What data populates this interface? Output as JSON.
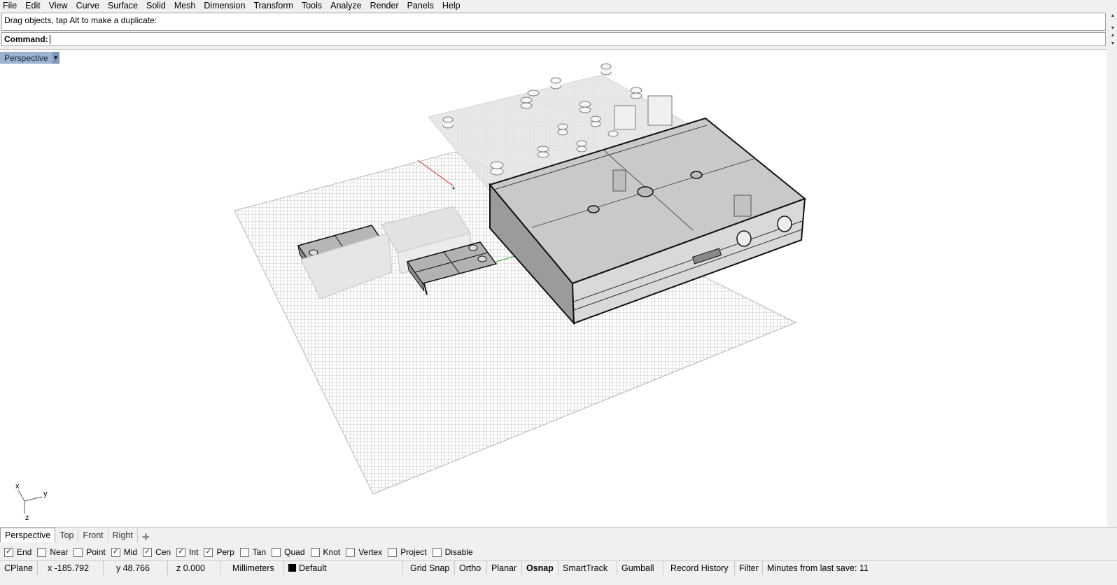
{
  "menu": [
    "File",
    "Edit",
    "View",
    "Curve",
    "Surface",
    "Solid",
    "Mesh",
    "Dimension",
    "Transform",
    "Tools",
    "Analyze",
    "Render",
    "Panels",
    "Help"
  ],
  "history": {
    "text": "Drag objects, tap Alt to make a duplicate:"
  },
  "command": {
    "label": "Command:",
    "value": ""
  },
  "viewport": {
    "title": "Perspective",
    "axis": {
      "x": "x",
      "y": "y",
      "z": "z"
    }
  },
  "tabs": [
    "Perspective",
    "Top",
    "Front",
    "Right"
  ],
  "osnaps": [
    {
      "label": "End",
      "checked": true
    },
    {
      "label": "Near",
      "checked": false
    },
    {
      "label": "Point",
      "checked": false
    },
    {
      "label": "Mid",
      "checked": true
    },
    {
      "label": "Cen",
      "checked": true
    },
    {
      "label": "Int",
      "checked": true
    },
    {
      "label": "Perp",
      "checked": true
    },
    {
      "label": "Tan",
      "checked": false
    },
    {
      "label": "Quad",
      "checked": false
    },
    {
      "label": "Knot",
      "checked": false
    },
    {
      "label": "Vertex",
      "checked": false
    },
    {
      "label": "Project",
      "checked": false
    },
    {
      "label": "Disable",
      "checked": false
    }
  ],
  "status": {
    "cplane": "CPlane",
    "x": "x -185.792",
    "y": "y 48.766",
    "z": "z 0.000",
    "units": "Millimeters",
    "layer": "Default",
    "grid_snap": "Grid Snap",
    "ortho": "Ortho",
    "planar": "Planar",
    "osnap": "Osnap",
    "smarttrack": "SmartTrack",
    "gumball": "Gumball",
    "record_history": "Record History",
    "filter": "Filter",
    "save_info": "Minutes from last save: 11"
  },
  "colors": {
    "viewport_title": "#9cb2cf",
    "background": "#f0f0f0"
  }
}
